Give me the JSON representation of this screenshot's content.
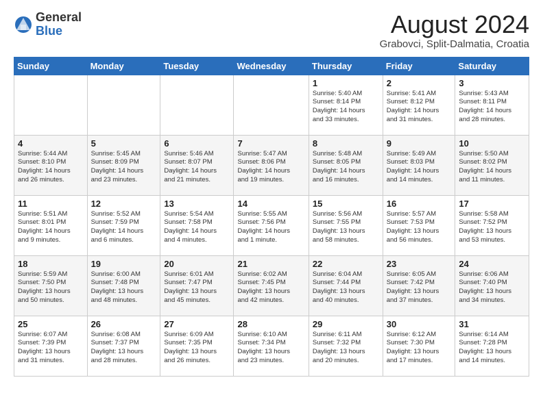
{
  "logo": {
    "general": "General",
    "blue": "Blue"
  },
  "title": "August 2024",
  "location": "Grabovci, Split-Dalmatia, Croatia",
  "days_header": [
    "Sunday",
    "Monday",
    "Tuesday",
    "Wednesday",
    "Thursday",
    "Friday",
    "Saturday"
  ],
  "weeks": [
    [
      {
        "num": "",
        "info": ""
      },
      {
        "num": "",
        "info": ""
      },
      {
        "num": "",
        "info": ""
      },
      {
        "num": "",
        "info": ""
      },
      {
        "num": "1",
        "info": "Sunrise: 5:40 AM\nSunset: 8:14 PM\nDaylight: 14 hours\nand 33 minutes."
      },
      {
        "num": "2",
        "info": "Sunrise: 5:41 AM\nSunset: 8:12 PM\nDaylight: 14 hours\nand 31 minutes."
      },
      {
        "num": "3",
        "info": "Sunrise: 5:43 AM\nSunset: 8:11 PM\nDaylight: 14 hours\nand 28 minutes."
      }
    ],
    [
      {
        "num": "4",
        "info": "Sunrise: 5:44 AM\nSunset: 8:10 PM\nDaylight: 14 hours\nand 26 minutes."
      },
      {
        "num": "5",
        "info": "Sunrise: 5:45 AM\nSunset: 8:09 PM\nDaylight: 14 hours\nand 23 minutes."
      },
      {
        "num": "6",
        "info": "Sunrise: 5:46 AM\nSunset: 8:07 PM\nDaylight: 14 hours\nand 21 minutes."
      },
      {
        "num": "7",
        "info": "Sunrise: 5:47 AM\nSunset: 8:06 PM\nDaylight: 14 hours\nand 19 minutes."
      },
      {
        "num": "8",
        "info": "Sunrise: 5:48 AM\nSunset: 8:05 PM\nDaylight: 14 hours\nand 16 minutes."
      },
      {
        "num": "9",
        "info": "Sunrise: 5:49 AM\nSunset: 8:03 PM\nDaylight: 14 hours\nand 14 minutes."
      },
      {
        "num": "10",
        "info": "Sunrise: 5:50 AM\nSunset: 8:02 PM\nDaylight: 14 hours\nand 11 minutes."
      }
    ],
    [
      {
        "num": "11",
        "info": "Sunrise: 5:51 AM\nSunset: 8:01 PM\nDaylight: 14 hours\nand 9 minutes."
      },
      {
        "num": "12",
        "info": "Sunrise: 5:52 AM\nSunset: 7:59 PM\nDaylight: 14 hours\nand 6 minutes."
      },
      {
        "num": "13",
        "info": "Sunrise: 5:54 AM\nSunset: 7:58 PM\nDaylight: 14 hours\nand 4 minutes."
      },
      {
        "num": "14",
        "info": "Sunrise: 5:55 AM\nSunset: 7:56 PM\nDaylight: 14 hours\nand 1 minute."
      },
      {
        "num": "15",
        "info": "Sunrise: 5:56 AM\nSunset: 7:55 PM\nDaylight: 13 hours\nand 58 minutes."
      },
      {
        "num": "16",
        "info": "Sunrise: 5:57 AM\nSunset: 7:53 PM\nDaylight: 13 hours\nand 56 minutes."
      },
      {
        "num": "17",
        "info": "Sunrise: 5:58 AM\nSunset: 7:52 PM\nDaylight: 13 hours\nand 53 minutes."
      }
    ],
    [
      {
        "num": "18",
        "info": "Sunrise: 5:59 AM\nSunset: 7:50 PM\nDaylight: 13 hours\nand 50 minutes."
      },
      {
        "num": "19",
        "info": "Sunrise: 6:00 AM\nSunset: 7:48 PM\nDaylight: 13 hours\nand 48 minutes."
      },
      {
        "num": "20",
        "info": "Sunrise: 6:01 AM\nSunset: 7:47 PM\nDaylight: 13 hours\nand 45 minutes."
      },
      {
        "num": "21",
        "info": "Sunrise: 6:02 AM\nSunset: 7:45 PM\nDaylight: 13 hours\nand 42 minutes."
      },
      {
        "num": "22",
        "info": "Sunrise: 6:04 AM\nSunset: 7:44 PM\nDaylight: 13 hours\nand 40 minutes."
      },
      {
        "num": "23",
        "info": "Sunrise: 6:05 AM\nSunset: 7:42 PM\nDaylight: 13 hours\nand 37 minutes."
      },
      {
        "num": "24",
        "info": "Sunrise: 6:06 AM\nSunset: 7:40 PM\nDaylight: 13 hours\nand 34 minutes."
      }
    ],
    [
      {
        "num": "25",
        "info": "Sunrise: 6:07 AM\nSunset: 7:39 PM\nDaylight: 13 hours\nand 31 minutes."
      },
      {
        "num": "26",
        "info": "Sunrise: 6:08 AM\nSunset: 7:37 PM\nDaylight: 13 hours\nand 28 minutes."
      },
      {
        "num": "27",
        "info": "Sunrise: 6:09 AM\nSunset: 7:35 PM\nDaylight: 13 hours\nand 26 minutes."
      },
      {
        "num": "28",
        "info": "Sunrise: 6:10 AM\nSunset: 7:34 PM\nDaylight: 13 hours\nand 23 minutes."
      },
      {
        "num": "29",
        "info": "Sunrise: 6:11 AM\nSunset: 7:32 PM\nDaylight: 13 hours\nand 20 minutes."
      },
      {
        "num": "30",
        "info": "Sunrise: 6:12 AM\nSunset: 7:30 PM\nDaylight: 13 hours\nand 17 minutes."
      },
      {
        "num": "31",
        "info": "Sunrise: 6:14 AM\nSunset: 7:28 PM\nDaylight: 13 hours\nand 14 minutes."
      }
    ]
  ]
}
